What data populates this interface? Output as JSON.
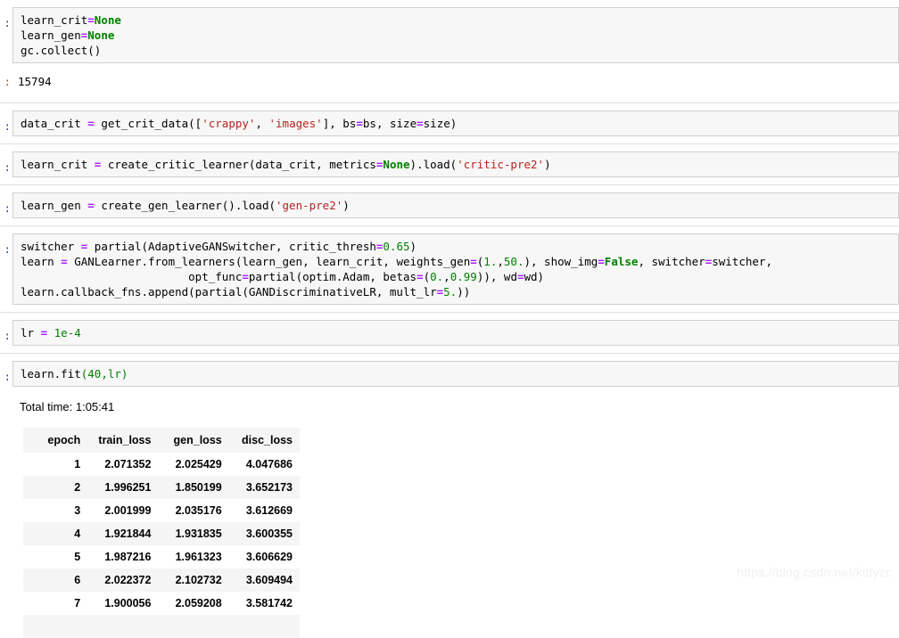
{
  "prompts": {
    "in": ":",
    "out": ":"
  },
  "cells": [
    {
      "name": "cell-cleanup",
      "prompt": ":",
      "lines": [
        [
          {
            "t": "learn_crit",
            "c": "nor"
          },
          {
            "t": "=",
            "c": "op"
          },
          {
            "t": "None",
            "c": "kw"
          }
        ],
        [
          {
            "t": "learn_gen",
            "c": "nor"
          },
          {
            "t": "=",
            "c": "op"
          },
          {
            "t": "None",
            "c": "kw"
          }
        ],
        [
          {
            "t": "gc.collect()",
            "c": "nor"
          }
        ]
      ]
    },
    {
      "name": "cell-get-crit-data",
      "prompt": ":",
      "lines": [
        [
          {
            "t": "data_crit ",
            "c": "nor"
          },
          {
            "t": "=",
            "c": "op"
          },
          {
            "t": " get_crit_data([",
            "c": "nor"
          },
          {
            "t": "'crappy'",
            "c": "str"
          },
          {
            "t": ", ",
            "c": "nor"
          },
          {
            "t": "'images'",
            "c": "str"
          },
          {
            "t": "], bs",
            "c": "nor"
          },
          {
            "t": "=",
            "c": "op"
          },
          {
            "t": "bs, size",
            "c": "nor"
          },
          {
            "t": "=",
            "c": "op"
          },
          {
            "t": "size)",
            "c": "nor"
          }
        ]
      ]
    },
    {
      "name": "cell-create-critic-learner",
      "prompt": ":",
      "lines": [
        [
          {
            "t": "learn_crit ",
            "c": "nor"
          },
          {
            "t": "=",
            "c": "op"
          },
          {
            "t": " create_critic_learner(data_crit, metrics",
            "c": "nor"
          },
          {
            "t": "=",
            "c": "op"
          },
          {
            "t": "None",
            "c": "kw"
          },
          {
            "t": ").load(",
            "c": "nor"
          },
          {
            "t": "'critic-pre2'",
            "c": "str"
          },
          {
            "t": ")",
            "c": "nor"
          }
        ]
      ]
    },
    {
      "name": "cell-create-gen-learner",
      "prompt": ":",
      "lines": [
        [
          {
            "t": "learn_gen ",
            "c": "nor"
          },
          {
            "t": "=",
            "c": "op"
          },
          {
            "t": " create_gen_learner().load(",
            "c": "nor"
          },
          {
            "t": "'gen-pre2'",
            "c": "str"
          },
          {
            "t": ")",
            "c": "nor"
          }
        ]
      ]
    },
    {
      "name": "cell-gan-learner",
      "prompt": ":",
      "lines": [
        [
          {
            "t": "switcher ",
            "c": "nor"
          },
          {
            "t": "=",
            "c": "op"
          },
          {
            "t": " partial(AdaptiveGANSwitcher, critic_thresh",
            "c": "nor"
          },
          {
            "t": "=",
            "c": "op"
          },
          {
            "t": "0.65",
            "c": "num"
          },
          {
            "t": ")",
            "c": "nor"
          }
        ],
        [
          {
            "t": "learn ",
            "c": "nor"
          },
          {
            "t": "=",
            "c": "op"
          },
          {
            "t": " GANLearner.from_learners(learn_gen, learn_crit, weights_gen",
            "c": "nor"
          },
          {
            "t": "=",
            "c": "op"
          },
          {
            "t": "(",
            "c": "nor"
          },
          {
            "t": "1.",
            "c": "num"
          },
          {
            "t": ",",
            "c": "nor"
          },
          {
            "t": "50.",
            "c": "num"
          },
          {
            "t": "), show_img",
            "c": "nor"
          },
          {
            "t": "=",
            "c": "op"
          },
          {
            "t": "False",
            "c": "kw"
          },
          {
            "t": ", switcher",
            "c": "nor"
          },
          {
            "t": "=",
            "c": "op"
          },
          {
            "t": "switcher,",
            "c": "nor"
          }
        ],
        [
          {
            "t": "                         opt_func",
            "c": "nor"
          },
          {
            "t": "=",
            "c": "op"
          },
          {
            "t": "partial(optim.Adam, betas",
            "c": "nor"
          },
          {
            "t": "=",
            "c": "op"
          },
          {
            "t": "(",
            "c": "nor"
          },
          {
            "t": "0.",
            "c": "num"
          },
          {
            "t": ",",
            "c": "nor"
          },
          {
            "t": "0.99",
            "c": "num"
          },
          {
            "t": ")), wd",
            "c": "nor"
          },
          {
            "t": "=",
            "c": "op"
          },
          {
            "t": "wd)",
            "c": "nor"
          }
        ],
        [
          {
            "t": "learn.callback_fns.append(partial(GANDiscriminativeLR, mult_lr",
            "c": "nor"
          },
          {
            "t": "=",
            "c": "op"
          },
          {
            "t": "5.",
            "c": "num"
          },
          {
            "t": "))",
            "c": "nor"
          }
        ]
      ]
    },
    {
      "name": "cell-lr",
      "prompt": ":",
      "lines": [
        [
          {
            "t": "lr ",
            "c": "nor"
          },
          {
            "t": "=",
            "c": "op"
          },
          {
            "t": " ",
            "c": "nor"
          },
          {
            "t": "1e-4",
            "c": "num"
          }
        ]
      ]
    },
    {
      "name": "cell-learn-fit",
      "prompt": ":",
      "lines": [
        [
          {
            "t": "learn.fit",
            "c": "nor"
          },
          {
            "t": "(",
            "c": "num"
          },
          {
            "t": "40",
            "c": "num"
          },
          {
            "t": ",",
            "c": "num"
          },
          {
            "t": "lr",
            "c": "num"
          },
          {
            "t": ")",
            "c": "num"
          }
        ]
      ]
    }
  ],
  "outputs": {
    "gc_collect_result": "15794",
    "total_time": "Total time: 1:05:41"
  },
  "results_table": {
    "headers": [
      "epoch",
      "train_loss",
      "gen_loss",
      "disc_loss"
    ],
    "rows": [
      [
        "1",
        "2.071352",
        "2.025429",
        "4.047686"
      ],
      [
        "2",
        "1.996251",
        "1.850199",
        "3.652173"
      ],
      [
        "3",
        "2.001999",
        "2.035176",
        "3.612669"
      ],
      [
        "4",
        "1.921844",
        "1.931835",
        "3.600355"
      ],
      [
        "5",
        "1.987216",
        "1.961323",
        "3.606629"
      ],
      [
        "6",
        "2.022372",
        "2.102732",
        "3.609494"
      ],
      [
        "7",
        "1.900056",
        "2.059208",
        "3.581742"
      ]
    ]
  },
  "watermark": "https://blog.csdn.net/kittyzc",
  "colors": {
    "cell_bg": "#f7f7f7",
    "cell_border": "#cfcfcf",
    "prompt_in": "#303F9F",
    "prompt_out": "#D84315",
    "string": "#BA2121",
    "keyword": "#008000",
    "number": "#008000",
    "operator": "#AA22FF",
    "row_stripe": "#f5f5f5",
    "separator": "#e0e0e0"
  }
}
